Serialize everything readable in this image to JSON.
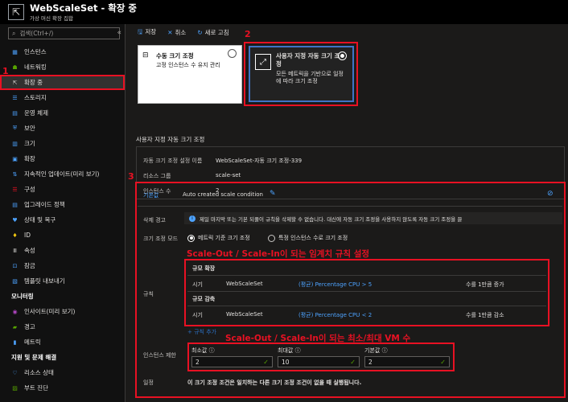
{
  "header": {
    "title": "WebScaleSet - 확장 중",
    "subtitle": "가상 머신 확장 집합"
  },
  "sidebar": {
    "search_placeholder": "검색(Ctrl+/)",
    "collapse": "«",
    "items": [
      {
        "label": "인스턴스",
        "icon": "instances-icon"
      },
      {
        "label": "네트워킹",
        "icon": "networking-icon"
      },
      {
        "label": "확장 중",
        "icon": "scaling-icon"
      },
      {
        "label": "스토리지",
        "icon": "storage-icon"
      },
      {
        "label": "운영 체제",
        "icon": "os-icon"
      },
      {
        "label": "보안",
        "icon": "security-icon"
      },
      {
        "label": "크기",
        "icon": "size-icon"
      },
      {
        "label": "확장",
        "icon": "extensions-icon"
      },
      {
        "label": "지속적인 업데이트(미리 보기)",
        "icon": "update-icon"
      },
      {
        "label": "구성",
        "icon": "config-icon"
      },
      {
        "label": "업그레이드 정책",
        "icon": "upgrade-icon"
      },
      {
        "label": "상태 및 복구",
        "icon": "health-icon"
      },
      {
        "label": "ID",
        "icon": "identity-icon"
      },
      {
        "label": "속성",
        "icon": "properties-icon"
      },
      {
        "label": "잠금",
        "icon": "lock-icon"
      },
      {
        "label": "템플릿 내보내기",
        "icon": "template-icon"
      }
    ],
    "section_monitoring": "모니터링",
    "monitoring_items": [
      {
        "label": "인사이트(미리 보기)",
        "icon": "insights-icon"
      },
      {
        "label": "경고",
        "icon": "alerts-icon"
      },
      {
        "label": "메트릭",
        "icon": "metrics-icon"
      }
    ],
    "section_support": "지원 및 문제 해결",
    "support_items": [
      {
        "label": "리소스 상태",
        "icon": "resource-health-icon"
      },
      {
        "label": "부트 진단",
        "icon": "boot-diag-icon"
      }
    ]
  },
  "markers": {
    "m1": "1",
    "m2": "2",
    "m3": "3"
  },
  "toolbar": {
    "save": "저장",
    "cancel": "취소",
    "refresh": "새로 고침"
  },
  "cards": {
    "manual_title": "수동 크기 조정",
    "manual_desc": "고정 인스턴스 수 유지 관리",
    "custom_title": "사용자 지정 자동 크기 조정",
    "custom_desc": "모든 메트릭을 기반으로 일정에 따라 크기 조정"
  },
  "settings": {
    "section_title": "사용자 지정 자동 크기 조정",
    "name_label": "자동 크기 조정 설정 이름",
    "name_value": "WebScaleSet-자동 크기 조정-339",
    "rg_label": "리소스 그룹",
    "rg_value": "scale-set",
    "count_label": "인스턴스 수",
    "count_value": "2"
  },
  "condition": {
    "default_label": "기본값",
    "name": "Auto created scale condition",
    "delete_warning_label": "삭제 경고",
    "delete_warning": "제일 마지막 또는 기본 되풀이 규칙을 삭제할 수 없습니다. 대신에 자동 크기 조정을 사용하지 않도록 자동 크기 조정을 끌",
    "mode_label": "크기 조정 모드",
    "mode_metric": "메트릭 기준 크기 조정",
    "mode_instance": "특정 인스턴스 수로 크기 조정",
    "rules_label": "규칙",
    "annot_rules": "Scale-Out / Scale-In이 되는 임계치 규칙 설정",
    "scale_out_header": "규모 확장",
    "scale_in_header": "규모 감축",
    "rule_when": "시기",
    "rule_resource": "WebScaleSet",
    "rule_out_cond": "(평균) Percentage CPU > 5",
    "rule_out_action": "수를 1만큼 증가",
    "rule_in_cond": "(평균) Percentage CPU < 2",
    "rule_in_action": "수를 1만큼 감소",
    "add_rule": "+ 규칙 추가",
    "annot_limits": "Scale-Out / Scale-In이 되는 최소/최대 VM 수",
    "limits_label": "인스턴스 제한",
    "min_label": "최소값",
    "max_label": "최대값",
    "def_label": "기본값",
    "min_value": "2",
    "max_value": "10",
    "def_value": "2",
    "schedule_label": "일정",
    "schedule_text": "이 크기 조정 조건은 일치하는 다른 크기 조정 조건이 없을 때 실행됩니다."
  }
}
